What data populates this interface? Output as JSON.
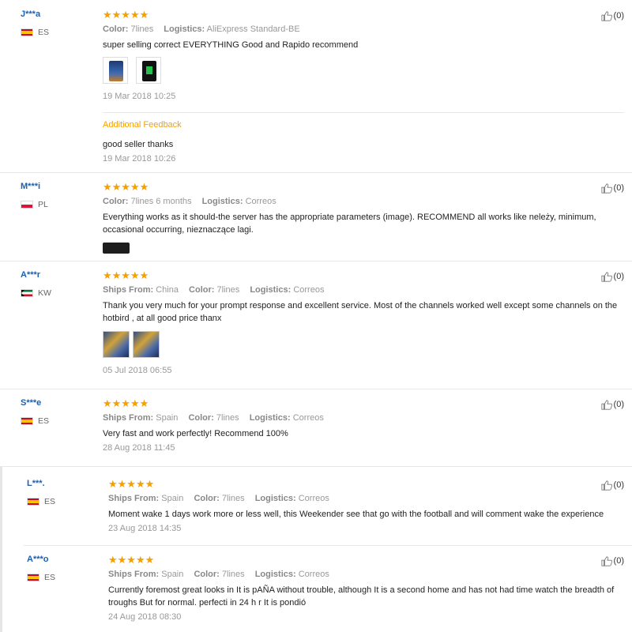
{
  "labels": {
    "color": "Color:",
    "logistics": "Logistics:",
    "ships_from": "Ships From:",
    "additional_feedback": "Additional Feedback"
  },
  "stars": "★★★★★",
  "reviews": [
    {
      "user": "J***a",
      "country": "ES",
      "flag": "es",
      "color": "7lines",
      "logistics": "AliExpress Standard-BE",
      "text": "super selling correct EVERYTHING Good and Rapido recommend",
      "date": "19 Mar 2018 10:25",
      "additional_text": "good seller thanks",
      "additional_date": "19 Mar 2018 10:26",
      "helpful": "(0)"
    },
    {
      "user": "M***i",
      "country": "PL",
      "flag": "pl",
      "color": "7lines 6 months",
      "logistics": "Correos",
      "text": "Everything works as it should-the server has the appropriate parameters (image). RECOMMEND all works like neleży, minimum, occasional occurring, nieznaczące lagi.",
      "helpful": "(0)"
    },
    {
      "user": "A***r",
      "country": "KW",
      "flag": "kw",
      "ships_from": "China",
      "color": "7lines",
      "logistics": "Correos",
      "text": "Thank you very much for your prompt response and excellent service. Most of the channels worked well except some channels on the hotbird , at all good price thanx",
      "date": "05 Jul 2018 06:55",
      "helpful": "(0)"
    },
    {
      "user": "S***e",
      "country": "ES",
      "flag": "es",
      "ships_from": "Spain",
      "color": "7lines",
      "logistics": "Correos",
      "text": "Very fast and work perfectly! Recommend 100%",
      "date": "28 Aug 2018 11:45",
      "helpful": "(0)"
    },
    {
      "user": "L***.",
      "country": "ES",
      "flag": "es",
      "ships_from": "Spain",
      "color": "7lines",
      "logistics": "Correos",
      "text": "Moment wake 1 days work more or less well, this Weekender see that go with the football and will comment wake the experience",
      "date": "23 Aug 2018 14:35",
      "helpful": "(0)"
    },
    {
      "user": "A***o",
      "country": "ES",
      "flag": "es",
      "ships_from": "Spain",
      "color": "7lines",
      "logistics": "Correos",
      "text": "Currently foremost great looks in It is pAÑA without trouble, although It is a second home and has not had time watch the breadth of troughs But for normal. perfecti in 24 h r It is pondió",
      "date": "24 Aug 2018 08:30",
      "helpful": "(0)"
    }
  ]
}
